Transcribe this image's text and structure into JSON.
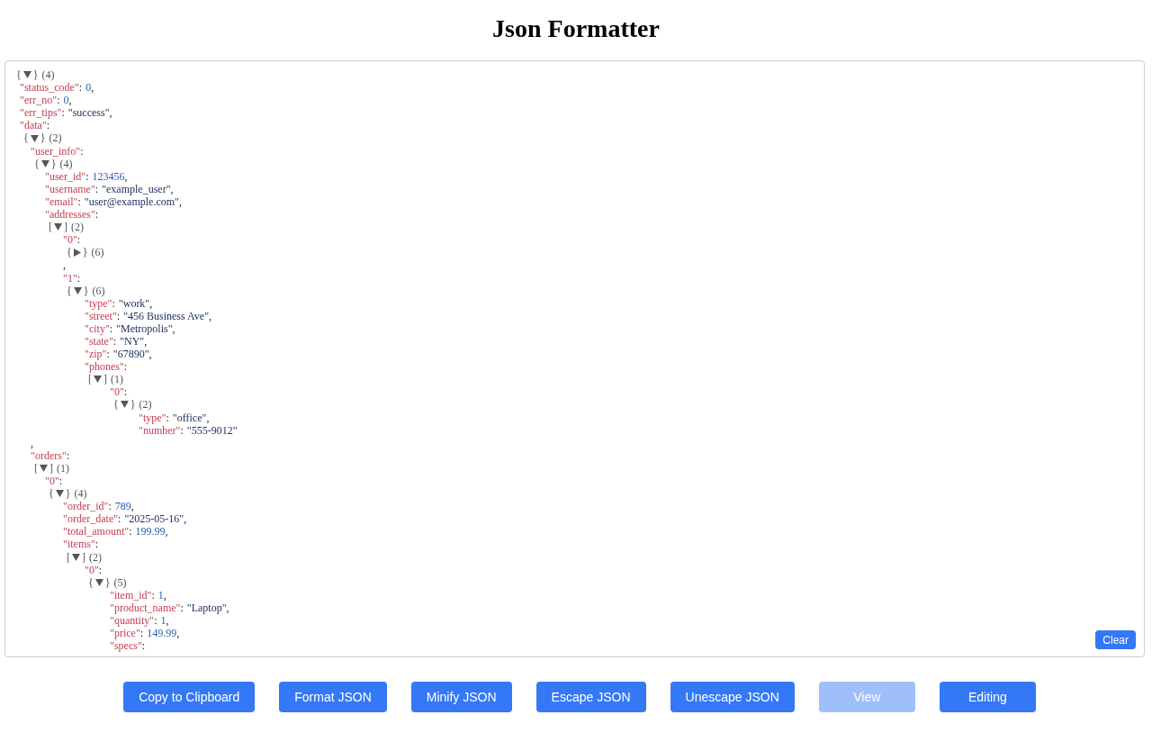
{
  "title": "Json Formatter",
  "editor": {
    "tree": {
      "open": "{",
      "close": "}",
      "count": "(4)",
      "expanded": true,
      "children": [
        {
          "key": "\"status_code\"",
          "colon": ":",
          "kind": "number",
          "value": "0",
          "comma": ","
        },
        {
          "key": "\"err_no\"",
          "colon": ":",
          "kind": "number",
          "value": "0",
          "comma": ","
        },
        {
          "key": "\"err_tips\"",
          "colon": ":",
          "kind": "string",
          "value": "\"success\"",
          "comma": ","
        },
        {
          "key": "\"data\"",
          "colon": ":",
          "kind": "container",
          "value": {
            "open": "{",
            "close": "}",
            "count": "(2)",
            "expanded": true,
            "children": [
              {
                "key": "\"user_info\"",
                "colon": ":",
                "kind": "container",
                "comma": ",",
                "value": {
                  "open": "{",
                  "close": "}",
                  "count": "(4)",
                  "expanded": true,
                  "children": [
                    {
                      "key": "\"user_id\"",
                      "colon": ":",
                      "kind": "number",
                      "value": "123456",
                      "comma": ","
                    },
                    {
                      "key": "\"username\"",
                      "colon": ":",
                      "kind": "string",
                      "value": "\"example_user\"",
                      "comma": ","
                    },
                    {
                      "key": "\"email\"",
                      "colon": ":",
                      "kind": "string",
                      "value": "\"user@example.com\"",
                      "comma": ","
                    },
                    {
                      "key": "\"addresses\"",
                      "colon": ":",
                      "kind": "container",
                      "value": {
                        "open": "[",
                        "close": "]",
                        "count": "(2)",
                        "expanded": true,
                        "children": [
                          {
                            "key": "\"0\"",
                            "colon": ":",
                            "kind": "container",
                            "comma": ",",
                            "value": {
                              "open": "{",
                              "close": "}",
                              "count": "(6)",
                              "expanded": false
                            }
                          },
                          {
                            "key": "\"1\"",
                            "colon": ":",
                            "kind": "container",
                            "value": {
                              "open": "{",
                              "close": "}",
                              "count": "(6)",
                              "expanded": true,
                              "children": [
                                {
                                  "key": "\"type\"",
                                  "colon": ":",
                                  "kind": "string",
                                  "value": "\"work\"",
                                  "comma": ","
                                },
                                {
                                  "key": "\"street\"",
                                  "colon": ":",
                                  "kind": "string",
                                  "value": "\"456 Business Ave\"",
                                  "comma": ","
                                },
                                {
                                  "key": "\"city\"",
                                  "colon": ":",
                                  "kind": "string",
                                  "value": "\"Metropolis\"",
                                  "comma": ","
                                },
                                {
                                  "key": "\"state\"",
                                  "colon": ":",
                                  "kind": "string",
                                  "value": "\"NY\"",
                                  "comma": ","
                                },
                                {
                                  "key": "\"zip\"",
                                  "colon": ":",
                                  "kind": "string",
                                  "value": "\"67890\"",
                                  "comma": ","
                                },
                                {
                                  "key": "\"phones\"",
                                  "colon": ":",
                                  "kind": "container",
                                  "value": {
                                    "open": "[",
                                    "close": "]",
                                    "count": "(1)",
                                    "expanded": true,
                                    "children": [
                                      {
                                        "key": "\"0\"",
                                        "colon": ":",
                                        "kind": "container",
                                        "value": {
                                          "open": "{",
                                          "close": "}",
                                          "count": "(2)",
                                          "expanded": true,
                                          "children": [
                                            {
                                              "key": "\"type\"",
                                              "colon": ":",
                                              "kind": "string",
                                              "value": "\"office\"",
                                              "comma": ","
                                            },
                                            {
                                              "key": "\"number\"",
                                              "colon": ":",
                                              "kind": "string",
                                              "value": "\"555-9012\""
                                            }
                                          ]
                                        }
                                      }
                                    ]
                                  }
                                }
                              ]
                            }
                          }
                        ]
                      }
                    }
                  ]
                }
              },
              {
                "key": "\"orders\"",
                "colon": ":",
                "kind": "container",
                "value": {
                  "open": "[",
                  "close": "]",
                  "count": "(1)",
                  "expanded": true,
                  "children": [
                    {
                      "key": "\"0\"",
                      "colon": ":",
                      "kind": "container",
                      "value": {
                        "open": "{",
                        "close": "}",
                        "count": "(4)",
                        "expanded": true,
                        "children": [
                          {
                            "key": "\"order_id\"",
                            "colon": ":",
                            "kind": "number",
                            "value": "789",
                            "comma": ","
                          },
                          {
                            "key": "\"order_date\"",
                            "colon": ":",
                            "kind": "string",
                            "value": "\"2025-05-16\"",
                            "comma": ","
                          },
                          {
                            "key": "\"total_amount\"",
                            "colon": ":",
                            "kind": "number",
                            "value": "199.99",
                            "comma": ","
                          },
                          {
                            "key": "\"items\"",
                            "colon": ":",
                            "kind": "container",
                            "value": {
                              "open": "[",
                              "close": "]",
                              "count": "(2)",
                              "expanded": true,
                              "children": [
                                {
                                  "key": "\"0\"",
                                  "colon": ":",
                                  "kind": "container",
                                  "value": {
                                    "open": "{",
                                    "close": "}",
                                    "count": "(5)",
                                    "expanded": true,
                                    "children": [
                                      {
                                        "key": "\"item_id\"",
                                        "colon": ":",
                                        "kind": "number",
                                        "value": "1",
                                        "comma": ","
                                      },
                                      {
                                        "key": "\"product_name\"",
                                        "colon": ":",
                                        "kind": "string",
                                        "value": "\"Laptop\"",
                                        "comma": ","
                                      },
                                      {
                                        "key": "\"quantity\"",
                                        "colon": ":",
                                        "kind": "number",
                                        "value": "1",
                                        "comma": ","
                                      },
                                      {
                                        "key": "\"price\"",
                                        "colon": ":",
                                        "kind": "number",
                                        "value": "149.99",
                                        "comma": ","
                                      },
                                      {
                                        "key": "\"specs\"",
                                        "colon": ":",
                                        "kind": "container"
                                      }
                                    ]
                                  }
                                }
                              ]
                            }
                          }
                        ]
                      }
                    }
                  ]
                }
              }
            ]
          }
        }
      ]
    },
    "clear_button": "Clear"
  },
  "buttons": [
    {
      "label": "Copy to Clipboard",
      "disabled": false
    },
    {
      "label": "Format JSON",
      "disabled": false
    },
    {
      "label": "Minify JSON",
      "disabled": false
    },
    {
      "label": "Escape JSON",
      "disabled": false
    },
    {
      "label": "Unescape JSON",
      "disabled": false
    },
    {
      "label": "View",
      "disabled": true
    },
    {
      "label": "Editing",
      "disabled": false
    }
  ]
}
